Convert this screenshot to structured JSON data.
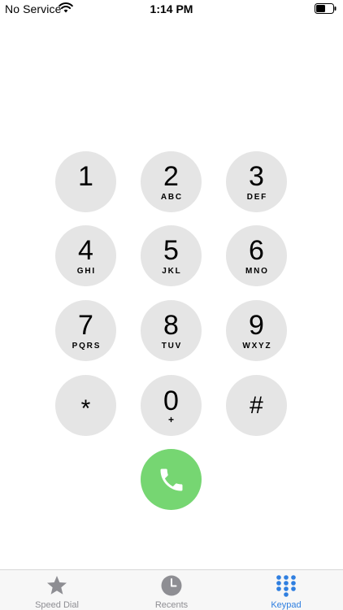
{
  "status_bar": {
    "carrier": "No Service",
    "time": "1:14 PM",
    "wifi_icon": "wifi-icon",
    "battery_icon": "battery-icon"
  },
  "keypad": {
    "keys": [
      {
        "digit": "1",
        "letters": ""
      },
      {
        "digit": "2",
        "letters": "ABC"
      },
      {
        "digit": "3",
        "letters": "DEF"
      },
      {
        "digit": "4",
        "letters": "GHI"
      },
      {
        "digit": "5",
        "letters": "JKL"
      },
      {
        "digit": "6",
        "letters": "MNO"
      },
      {
        "digit": "7",
        "letters": "PQRS"
      },
      {
        "digit": "8",
        "letters": "TUV"
      },
      {
        "digit": "9",
        "letters": "WXYZ"
      },
      {
        "digit": "*",
        "letters": ""
      },
      {
        "digit": "0",
        "letters": "+"
      },
      {
        "digit": "#",
        "letters": ""
      }
    ],
    "call_icon": "phone-icon"
  },
  "tab_bar": {
    "tabs": [
      {
        "label": "Speed Dial",
        "icon": "star-icon",
        "active": false
      },
      {
        "label": "Recents",
        "icon": "clock-icon",
        "active": false
      },
      {
        "label": "Keypad",
        "icon": "keypad-icon",
        "active": true
      }
    ]
  },
  "colors": {
    "key_background": "#e5e5e5",
    "call_green": "#76d672",
    "active_tab": "#2f7fe0",
    "inactive_tab": "#8e8e93"
  }
}
